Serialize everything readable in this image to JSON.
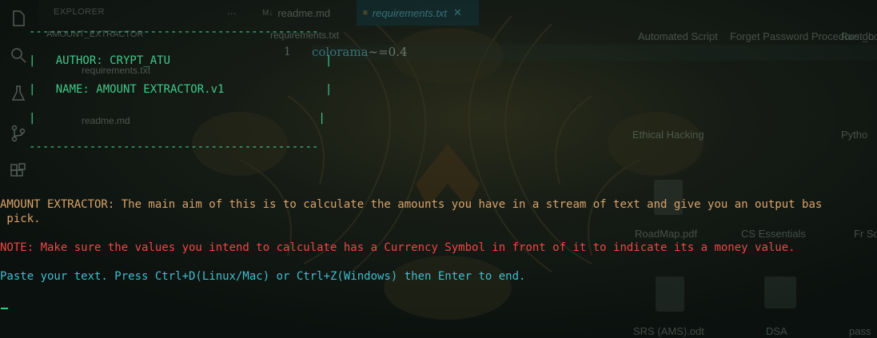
{
  "colors": {
    "background": "#0d1411",
    "banner_green": "#40c98a",
    "description_orange": "#d9a36a",
    "note_red": "#ee4747",
    "prompt_cyan": "#41bdd0"
  },
  "editor": {
    "explorer_title": "EXPLORER",
    "more_icon": "...",
    "tabs": [
      {
        "label": "readme.md",
        "icon": "markdown-icon",
        "active": false
      },
      {
        "label": "requirements.txt",
        "icon": "text-file-icon",
        "active": true
      }
    ],
    "close_glyph": "✕",
    "folder_label": "AMOUNT_EXTRACTOR",
    "tree_files": [
      "requirements.txt",
      "readme.md"
    ],
    "breadcrumb": "requirements.txt",
    "line_number": "1",
    "code_package": "colorama",
    "code_rest": "~=0.4"
  },
  "desktop": {
    "items": [
      "Automated Script",
      "Forget Password Procedure.docx",
      "Rust_L",
      "Ethical Hacking",
      "Pytho",
      "RoadMap.pdf",
      "CS Essentials",
      "Fr Sched",
      "SRS (AMS).odt",
      "DSA",
      "pass"
    ]
  },
  "terminal": {
    "banner": {
      "border": "-------------------------------------------",
      "author_line": "|   AUTHOR: CRYPT_ATU                       |",
      "name_line": "|   NAME: AMOUNT EXTRACTOR.v1               |",
      "blank_line": "|                                          |"
    },
    "description_line1": "AMOUNT EXTRACTOR: The main aim of this is to calculate the amounts you have in a stream of text and give you an output bas",
    "description_line2": " pick.",
    "note": "NOTE: Make sure the values you intend to calculate has a Currency Symbol in front of it to indicate its a money value.",
    "prompt": "Paste your text. Press Ctrl+D(Linux/Mac) or Ctrl+Z(Windows) then Enter to end."
  }
}
